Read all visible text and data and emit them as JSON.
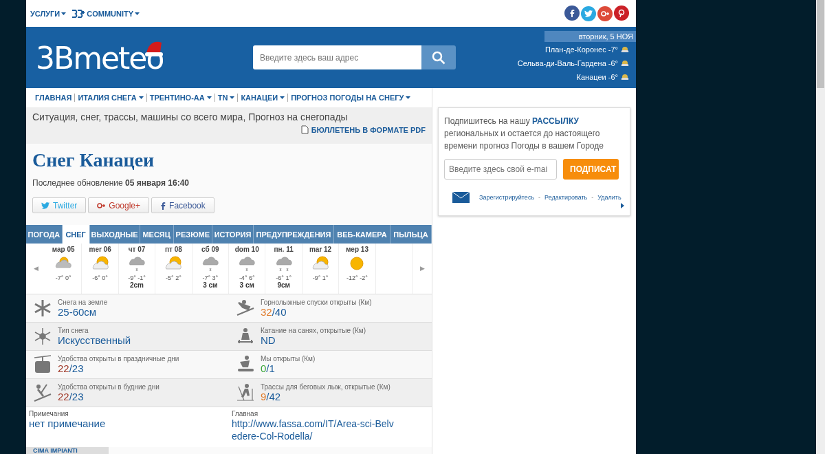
{
  "topbar": {
    "menus": [
      {
        "label": "УСЛУГИ",
        "kind": "text"
      },
      {
        "label": "COMMUNITY",
        "kind": "logo"
      }
    ],
    "social": [
      {
        "kind": "facebook",
        "color": "#3b5998"
      },
      {
        "kind": "twitter",
        "color": "#2ba9e1"
      },
      {
        "kind": "googleplus",
        "color": "#dd4b39"
      },
      {
        "kind": "pinterest",
        "color": "#cb2027"
      }
    ]
  },
  "header": {
    "logo": "3Bmeteo",
    "search": {
      "placeholder": "Введите здесь ваш адрес"
    },
    "date": "вторник, 5 НОЯ",
    "places": [
      {
        "name": "План-де-Коронес",
        "temp": "-7°"
      },
      {
        "name": "Сельва-ди-Валь-Гардена",
        "temp": "-6°"
      },
      {
        "name": "Канацеи",
        "temp": "-6°"
      }
    ]
  },
  "nav": [
    {
      "label": "ГЛАВНАЯ",
      "dropdown": false
    },
    {
      "label": "ИТАЛИЯ СНЕГА",
      "dropdown": true
    },
    {
      "label": "ТРЕНТИНО-АА",
      "dropdown": true
    },
    {
      "label": "TN",
      "dropdown": true
    },
    {
      "label": "КАНАЦЕИ",
      "dropdown": true
    },
    {
      "label": "ПРОГНОЗ ПОГОДЫ НА СНЕГУ",
      "dropdown": true
    }
  ],
  "subtitle": "Ситуация, снег, трассы, машины со всего мира, Прогноз на снегопады",
  "pdf_link": "БЮЛЛЕТЕНЬ В ФОРМАТЕ PDF",
  "title": "Снег Канацеи",
  "updated": "Последнее обновление **05 января 16:40**",
  "share": [
    {
      "label": "Twitter",
      "kind": "twitter"
    },
    {
      "label": "Google+",
      "kind": "googleplus"
    },
    {
      "label": "Facebook",
      "kind": "facebook"
    }
  ],
  "tabs": [
    {
      "label": "ПОГОДА",
      "selected": false
    },
    {
      "label": "СНЕГ",
      "selected": true
    },
    {
      "label": "ВЫХОДНЫЕ",
      "selected": false
    },
    {
      "label": "МЕСЯЦ",
      "selected": false
    },
    {
      "label": "РЕЗЮМЕ",
      "selected": false
    },
    {
      "label": "ИСТОРИЯ",
      "selected": false
    },
    {
      "label": "ПРЕДУПРЕЖДЕНИЯ",
      "selected": false
    },
    {
      "label": "ВЕБ-КАМЕРА",
      "selected": false
    },
    {
      "label": "ПЫЛЬЦА",
      "selected": false
    }
  ],
  "forecast": {
    "prev": "◀",
    "next": "▶",
    "days": [
      {
        "day": "мар 05",
        "kind": "cloudsun",
        "temps": "-7° 0°"
      },
      {
        "day": "mer 06",
        "kind": "suncloud",
        "temps": "-6° 0°"
      },
      {
        "day": "чт 07",
        "kind": "snow",
        "temps": "-9° -1°",
        "snow": "2cm"
      },
      {
        "day": "пт 08",
        "kind": "suncloud",
        "temps": "-5° 2°"
      },
      {
        "day": "сб 09",
        "kind": "snow",
        "temps": "-7° 3°",
        "snow": "3 см"
      },
      {
        "day": "dom 10",
        "kind": "snow",
        "temps": "-4° 6°",
        "snow": "3 см"
      },
      {
        "day": "пн. 11",
        "kind": "heavysnow",
        "temps": "-6° 1°",
        "snow": "9см"
      },
      {
        "day": "mar 12",
        "kind": "suncloud",
        "temps": "-9° 1°"
      },
      {
        "day": "мер 13",
        "kind": "sun",
        "temps": "-12° -2°"
      }
    ]
  },
  "stats": [
    {
      "kind": "snowflake",
      "label": "Снега на земле",
      "value": "25-60см"
    },
    {
      "kind": "skier",
      "label": "Горнолыжные спуски открыты (Км)",
      "open": "32",
      "total": "/40",
      "color": "#e07b2a"
    },
    {
      "kind": "crystal",
      "label": "Тип снега",
      "value": "Искусственный"
    },
    {
      "kind": "sled",
      "label": "Катание на санях, открытые (Км)",
      "value": "ND"
    },
    {
      "kind": "cablecar",
      "label": "Удобства открыты в праздничные дни",
      "open": "22",
      "total": "/23",
      "color": "#a03a2a"
    },
    {
      "kind": "snowboarder",
      "label": "Мы открыты (Км)",
      "open": "0",
      "total": "/1",
      "color": "#3aa53a"
    },
    {
      "kind": "jumper",
      "label": "Удобства открыты в будние дни",
      "open": "22",
      "total": "/23",
      "color": "#a03a2a"
    },
    {
      "kind": "crosscountry",
      "label": "Трассы для беговых лыж, открытые (Км)",
      "open": "9",
      "total": "/42",
      "color": "#e07b2a"
    }
  ],
  "notes": {
    "label": "Примечания",
    "value": "нет примечание"
  },
  "home": {
    "label": "Главная",
    "value": "http://www.fassa.com/IT/Area-sci-Belvedere-Col-Rodella/"
  },
  "bottom_tab": "CIMA IMPIANTI",
  "newsletter": {
    "text": "Подпишитесь на нашу **РАССЫЛКУ** региональных и остается до настоящего времени прогноз Погоды в вашем Городе",
    "placeholder": "Введите здесь свой e-mai",
    "button": "ПОДПИСАТ",
    "links": [
      "Зарегистрируйтесь",
      "Редактировать",
      "Удалить"
    ],
    "separator": "-"
  }
}
